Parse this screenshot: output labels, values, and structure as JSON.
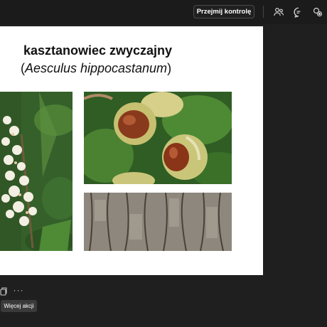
{
  "toolbar": {
    "take_control_label": "Przejmij kontrolę",
    "icons": [
      "people-icon",
      "chat-icon",
      "copilot-icon"
    ]
  },
  "slide": {
    "title": "kasztanowiec zwyczajny",
    "subtitle_open": "(",
    "subtitle_latin": "Aesculus hippocastanum",
    "subtitle_close": ")",
    "images": [
      "horse-chestnut-flower-photo",
      "conker-fruit-photo",
      "tree-bark-photo"
    ]
  },
  "bottom_bar": {
    "icons": [
      "copy-icon",
      "more-icon"
    ],
    "more_glyph": "···",
    "tooltip": "Więcej akcji"
  },
  "colors": {
    "background": "#1f1f1f",
    "slide": "#ffffff",
    "tooltip_bg": "#3a3a3a"
  }
}
